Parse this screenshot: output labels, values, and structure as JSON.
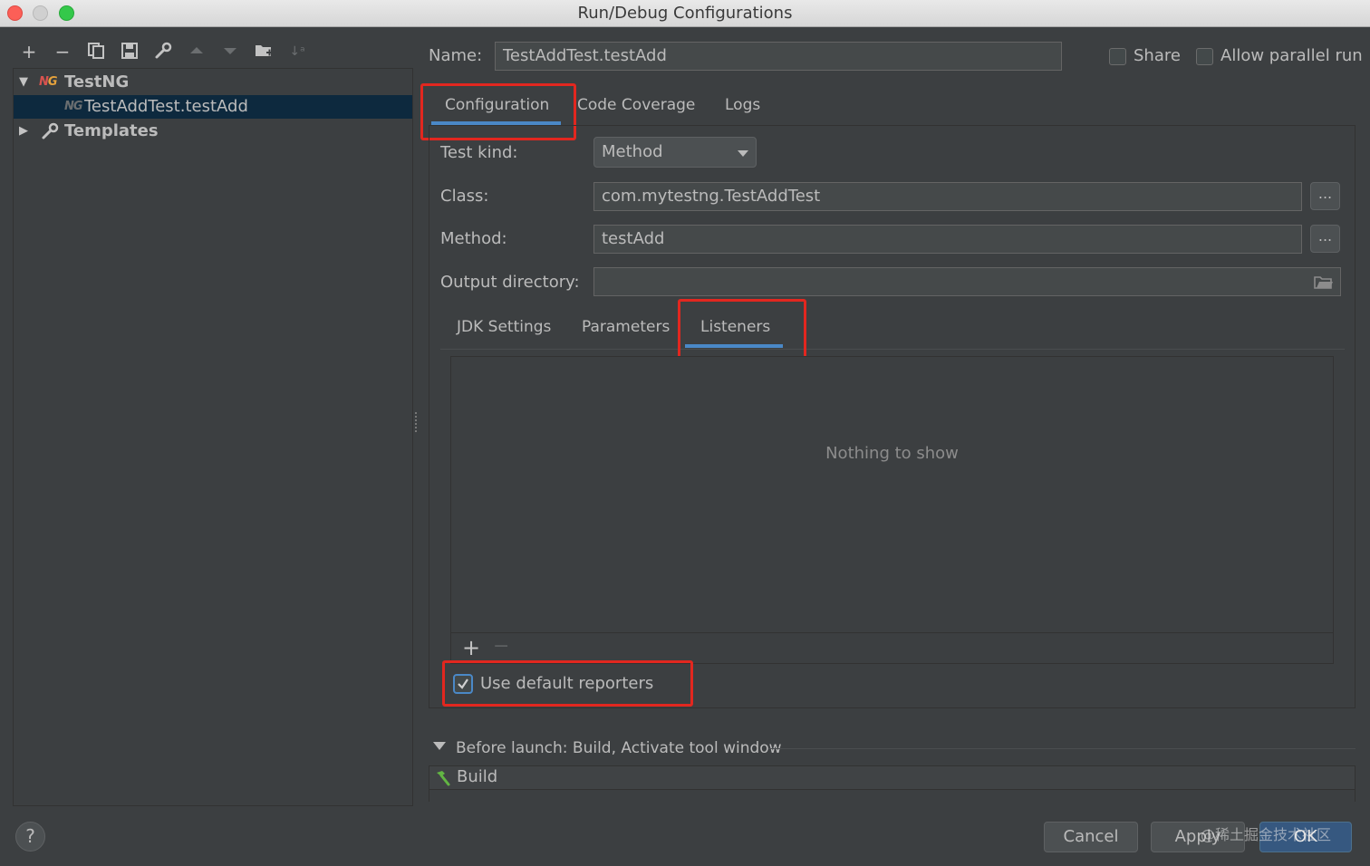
{
  "window": {
    "title": "Run/Debug Configurations"
  },
  "toolbar": {
    "icons": [
      "add-icon",
      "remove-icon",
      "copy-icon",
      "save-icon",
      "wrench-icon",
      "move-up-icon",
      "move-down-icon",
      "folder-icon",
      "sort-icon"
    ]
  },
  "tree": {
    "group": {
      "label": "TestNG",
      "icon": "testng-icon"
    },
    "selected_item": {
      "label": "TestAddTest.testAdd",
      "icon": "testng-icon"
    },
    "templates": {
      "label": "Templates",
      "icon": "wrench-icon"
    }
  },
  "form": {
    "name_label": "Name:",
    "name_value": "TestAddTest.testAdd",
    "share_label": "Share",
    "share_checked": false,
    "parallel_label": "Allow parallel run",
    "parallel_checked": false
  },
  "tabs": [
    {
      "label": "Configuration",
      "active": true
    },
    {
      "label": "Code Coverage",
      "active": false
    },
    {
      "label": "Logs",
      "active": false
    }
  ],
  "config": {
    "test_kind_label": "Test kind:",
    "test_kind_value": "Method",
    "class_label": "Class:",
    "class_value": "com.mytestng.TestAddTest",
    "method_label": "Method:",
    "method_value": "testAdd",
    "output_label": "Output directory:",
    "output_value": "",
    "browse_label": "..."
  },
  "subtabs": [
    {
      "label": "JDK Settings",
      "active": false
    },
    {
      "label": "Parameters",
      "active": false
    },
    {
      "label": "Listeners",
      "active": true
    }
  ],
  "listeners": {
    "empty_text": "Nothing to show",
    "add": "+",
    "remove": "−",
    "use_default_label": "Use default reporters",
    "use_default_checked": true
  },
  "before_launch": {
    "header": "Before launch: Build, Activate tool window",
    "items": [
      "Build"
    ]
  },
  "buttons": {
    "cancel": "Cancel",
    "apply": "Apply",
    "ok": "OK",
    "help": "?"
  },
  "watermark": "@稀土掘金技术社区",
  "colors": {
    "accent": "#4a88c7",
    "highlight_box": "#e2271f",
    "selection": "#0d293e",
    "background": "#3c3f41"
  }
}
